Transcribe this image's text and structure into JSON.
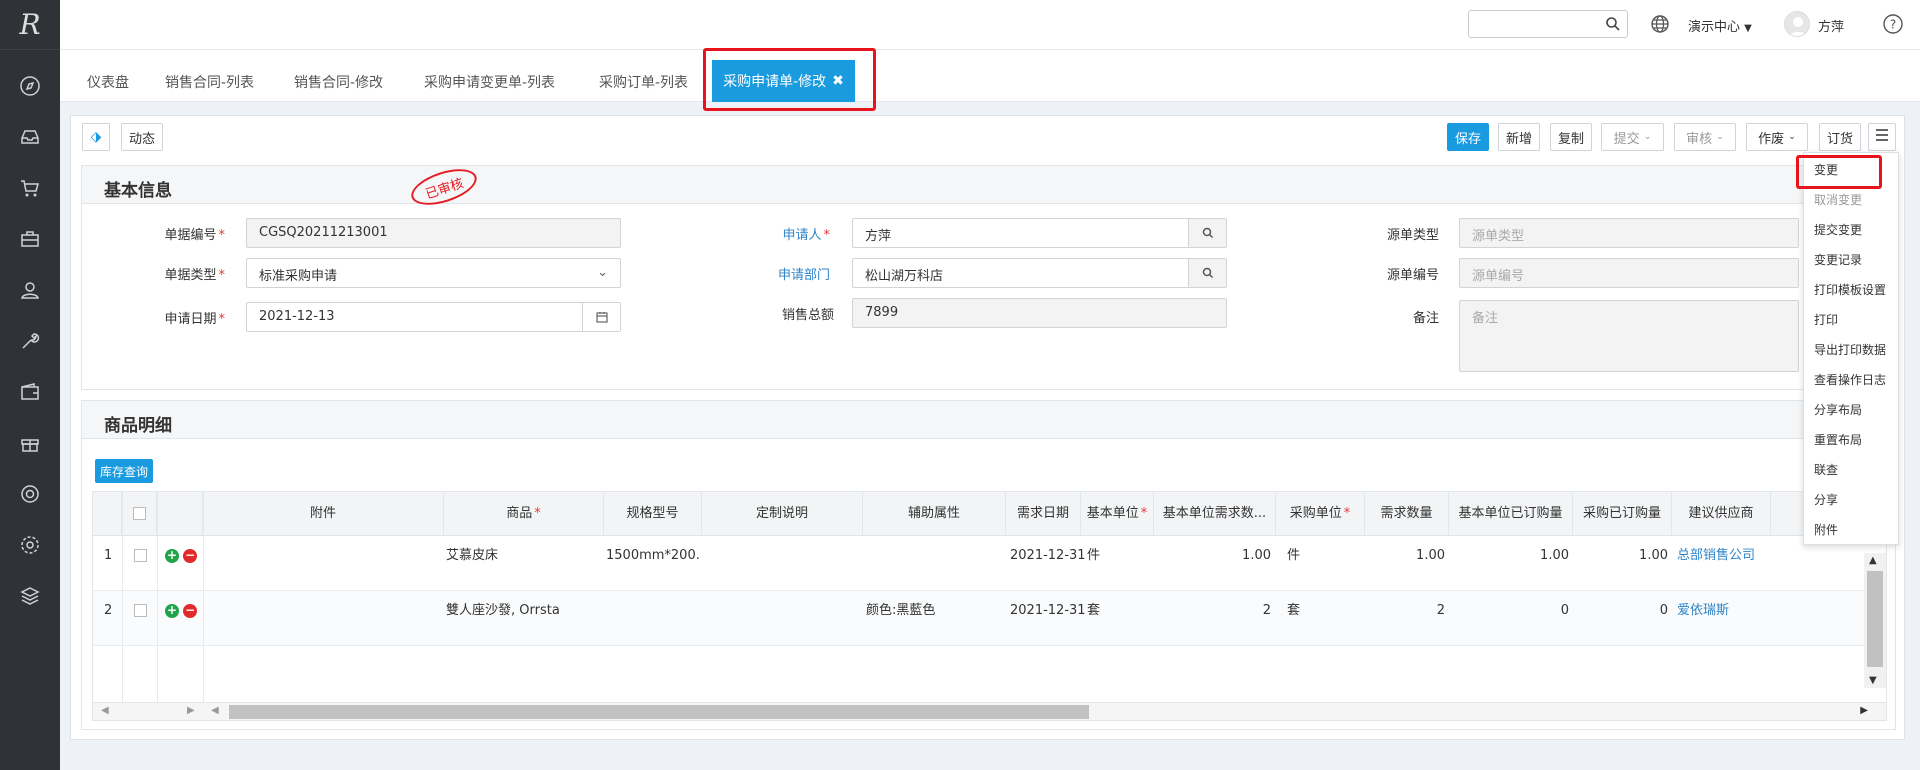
{
  "app": {
    "logo_text": "R"
  },
  "sidebar": {
    "icons": [
      "compass-icon",
      "inbox-icon",
      "cart-icon",
      "briefcase-icon",
      "user-icon",
      "wrench-icon",
      "wallet-icon",
      "gift-icon",
      "lifebuoy-icon",
      "gear-icon",
      "layers-icon"
    ]
  },
  "topbar": {
    "search_placeholder": "",
    "center_label": "演示中心",
    "username": "方萍"
  },
  "tabs": [
    {
      "label": "仪表盘"
    },
    {
      "label": "销售合同-列表"
    },
    {
      "label": "销售合同-修改"
    },
    {
      "label": "采购申请变更单-列表"
    },
    {
      "label": "采购订单-列表"
    }
  ],
  "active_tab": {
    "label": "采购申请单-修改"
  },
  "toolbar": {
    "dynamic_label": "动态",
    "save": "保存",
    "new": "新增",
    "copy": "复制",
    "submit": "提交",
    "audit": "审核",
    "void": "作废",
    "order": "订货"
  },
  "basic_info": {
    "title": "基本信息",
    "stamp": "已审核",
    "doc_no_label": "单据编号",
    "doc_no": "CGSQ20211213001",
    "doc_type_label": "单据类型",
    "doc_type": "标准采购申请",
    "apply_date_label": "申请日期",
    "apply_date": "2021-12-13",
    "applicant_label": "申请人",
    "applicant": "方萍",
    "dept_label": "申请部门",
    "dept": "松山湖万科店",
    "sales_total_label": "销售总额",
    "sales_total": "7899",
    "src_type_label": "源单类型",
    "src_type_ph": "源单类型",
    "src_no_label": "源单编号",
    "src_no_ph": "源单编号",
    "remark_label": "备注",
    "remark_ph": "备注"
  },
  "detail": {
    "title": "商品明细",
    "stock_query": "库存查询",
    "columns": [
      "附件",
      "商品",
      "规格型号",
      "定制说明",
      "辅助属性",
      "需求日期",
      "基本单位",
      "基本单位需求数...",
      "采购单位",
      "需求数量",
      "基本单位已订购量",
      "采购已订购量",
      "建议供应商"
    ],
    "rows": [
      {
        "no": "1",
        "product": "艾慕皮床",
        "spec": "1500mm*200...",
        "custom": "",
        "aux": "",
        "date": "2021-12-31",
        "unit": "件",
        "qty_base": "1.00",
        "p_unit": "件",
        "qty": "1.00",
        "ordered_base": "1.00",
        "ordered": "1.00",
        "supplier": "总部销售公司"
      },
      {
        "no": "2",
        "product": "雙人座沙發, Orrsta",
        "spec": "",
        "custom": "",
        "aux": "颜色:黑藍色",
        "date": "2021-12-31",
        "unit": "套",
        "qty_base": "2",
        "p_unit": "套",
        "qty": "2",
        "ordered_base": "0",
        "ordered": "0",
        "supplier": "爱依瑞斯"
      }
    ]
  },
  "menu": {
    "items": [
      {
        "label": "变更"
      },
      {
        "label": "取消变更"
      },
      {
        "label": "提交变更"
      },
      {
        "label": "变更记录"
      },
      {
        "label": "打印模板设置"
      },
      {
        "label": "打印"
      },
      {
        "label": "导出打印数据"
      },
      {
        "label": "查看操作日志"
      },
      {
        "label": "分享布局"
      },
      {
        "label": "重置布局"
      },
      {
        "label": "联查"
      },
      {
        "label": "分享"
      },
      {
        "label": "附件"
      }
    ]
  },
  "colors": {
    "primary": "#1a9be0",
    "sidebar": "#2f3337",
    "highlight": "#e8141b"
  }
}
